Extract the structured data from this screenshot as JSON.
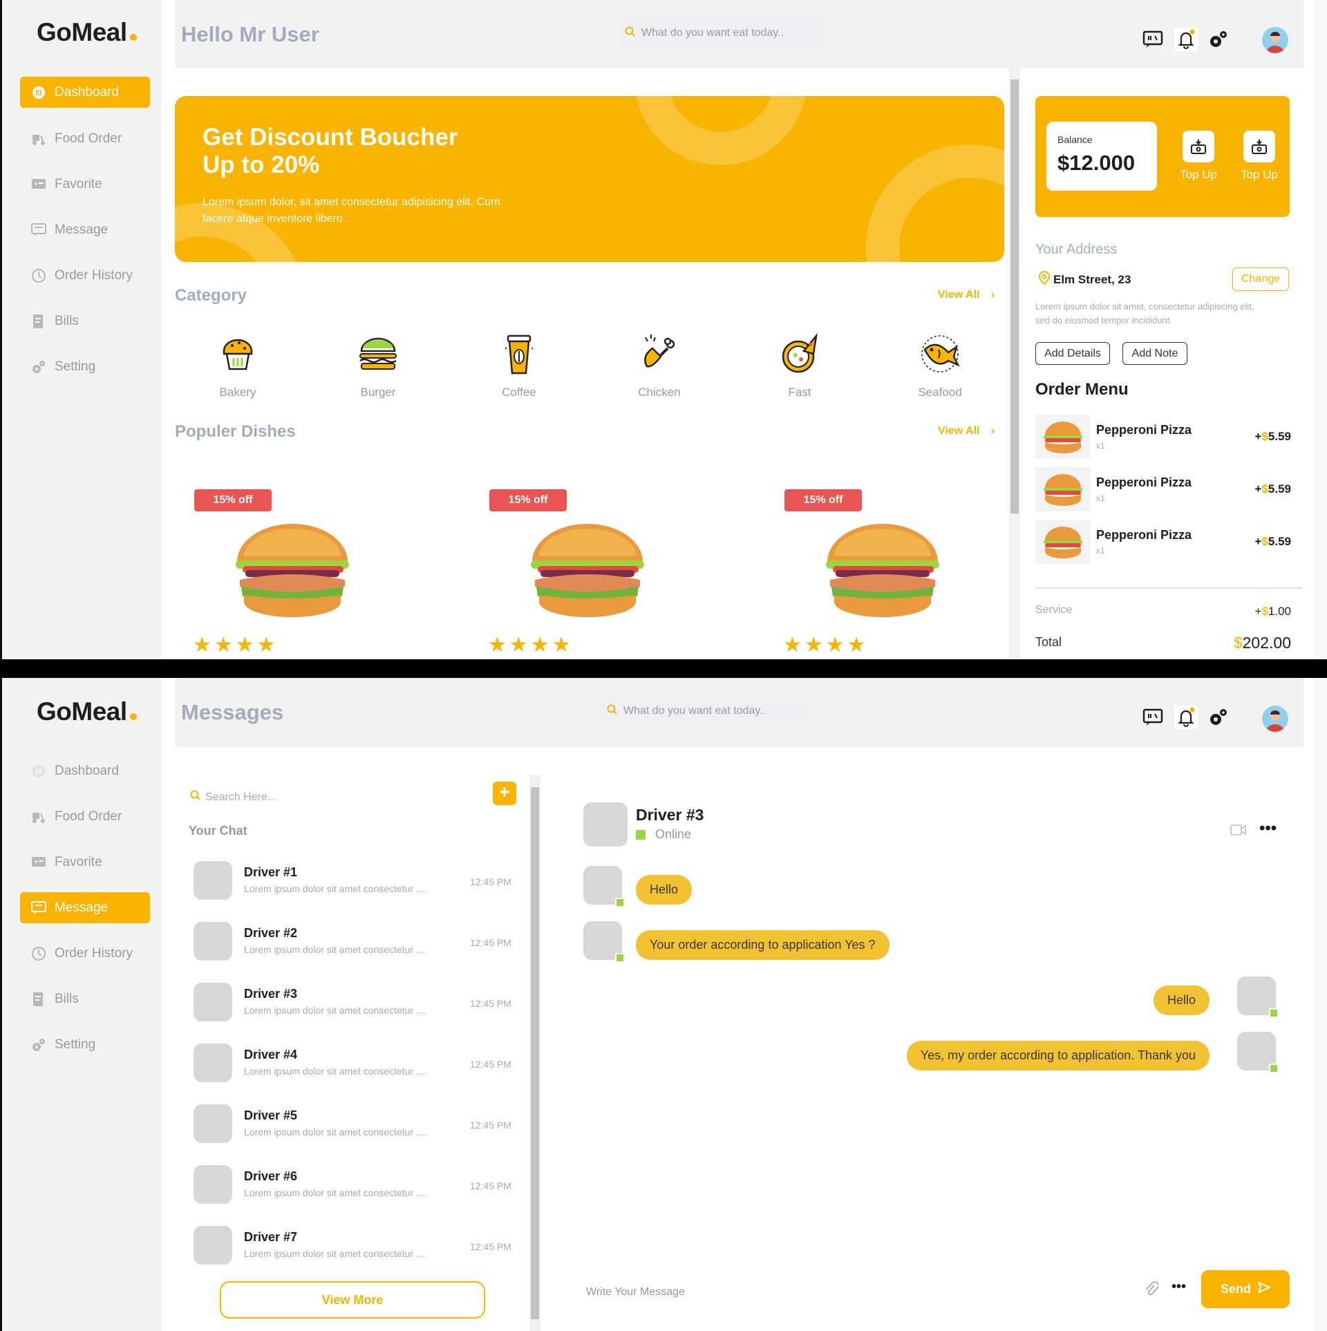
{
  "app": {
    "name": "GoMeal"
  },
  "nav": {
    "items": [
      {
        "label": "Dashboard"
      },
      {
        "label": "Food Order"
      },
      {
        "label": "Favorite"
      },
      {
        "label": "Message"
      },
      {
        "label": "Order History"
      },
      {
        "label": "Bills"
      },
      {
        "label": "Setting"
      }
    ]
  },
  "dashboard": {
    "header": {
      "title": "Hello Mr User",
      "search_placeholder": "What do you want eat today.."
    },
    "banner": {
      "title_line1": "Get Discount Boucher",
      "title_line2": "Up to 20%",
      "text": "Lorem ipsum dolor, sit amet consectetur adipisicing elit. Cum facere atque inventore libero ."
    },
    "category": {
      "title": "Category",
      "view_all": "View All",
      "items": [
        {
          "label": "Bakery"
        },
        {
          "label": "Burger"
        },
        {
          "label": "Coffee"
        },
        {
          "label": "Chicken"
        },
        {
          "label": "Fast"
        },
        {
          "label": "Seafood"
        }
      ]
    },
    "popular": {
      "title": "Populer Dishes",
      "view_all": "View All",
      "dishes": [
        {
          "badge": "15% off",
          "rating": 4
        },
        {
          "badge": "15% off",
          "rating": 4
        },
        {
          "badge": "15% off",
          "rating": 4
        }
      ]
    },
    "balance": {
      "label": "Balance",
      "amount": "$12.000",
      "actions": [
        {
          "label": "Top Up"
        },
        {
          "label": "Top Up"
        }
      ]
    },
    "address": {
      "title": "Your Address",
      "street": "Elm Street, 23",
      "change": "Change",
      "note": "Lorem ipsum dolor sit amet, consectetur adipiscing elit, sed do eiusmod tempor incididunt.",
      "add_details": "Add Details",
      "add_note": "Add Note"
    },
    "order_menu": {
      "title": "Order Menu",
      "items": [
        {
          "name": "Pepperoni Pizza",
          "qty": "x1",
          "sign": "+",
          "currency": "$",
          "price": "5.59"
        },
        {
          "name": "Pepperoni Pizza",
          "qty": "x1",
          "sign": "+",
          "currency": "$",
          "price": "5.59"
        },
        {
          "name": "Pepperoni Pizza",
          "qty": "x1",
          "sign": "+",
          "currency": "$",
          "price": "5.59"
        }
      ]
    },
    "summary": {
      "service_label": "Service",
      "service_sign": "+",
      "service_currency": "$",
      "service_value": "1.00",
      "total_label": "Total",
      "total_currency": "$",
      "total_value": "202.00"
    }
  },
  "messages": {
    "header": {
      "title": "Messages",
      "search_placeholder": "What do you want eat today.."
    },
    "list": {
      "search_placeholder": "Search Here...",
      "section_title": "Your Chat",
      "view_more": "View More",
      "chats": [
        {
          "name": "Driver #1",
          "preview": "Lorem ipsum dolor sit amet consectetur ....",
          "time": "12:45 PM"
        },
        {
          "name": "Driver #2",
          "preview": "Lorem ipsum dolor sit amet consectetur ....",
          "time": "12:45 PM"
        },
        {
          "name": "Driver #3",
          "preview": "Lorem ipsum dolor sit amet consectetur ....",
          "time": "12:45 PM"
        },
        {
          "name": "Driver #4",
          "preview": "Lorem ipsum dolor sit amet consectetur ....",
          "time": "12:45 PM"
        },
        {
          "name": "Driver #5",
          "preview": "Lorem ipsum dolor sit amet consectetur ....",
          "time": "12:45 PM"
        },
        {
          "name": "Driver #6",
          "preview": "Lorem ipsum dolor sit amet consectetur ....",
          "time": "12:45 PM"
        },
        {
          "name": "Driver #7",
          "preview": "Lorem ipsum dolor sit amet consectetur ....",
          "time": "12:45 PM"
        }
      ]
    },
    "conversation": {
      "name": "Driver #3",
      "status": "Online",
      "messages": [
        {
          "from": "them",
          "text": "Hello"
        },
        {
          "from": "them",
          "text": "Your order according to application Yes ?"
        },
        {
          "from": "me",
          "text": "Hello"
        },
        {
          "from": "me",
          "text": "Yes, my order according to application. Thank you"
        }
      ],
      "input_placeholder": "Write Your Message",
      "send": "Send"
    }
  },
  "colors": {
    "accent": "#f8b400",
    "badge": "#e95454",
    "bubble": "#f3c233",
    "online": "#9bd63f",
    "muted_title": "#a3acbd"
  }
}
